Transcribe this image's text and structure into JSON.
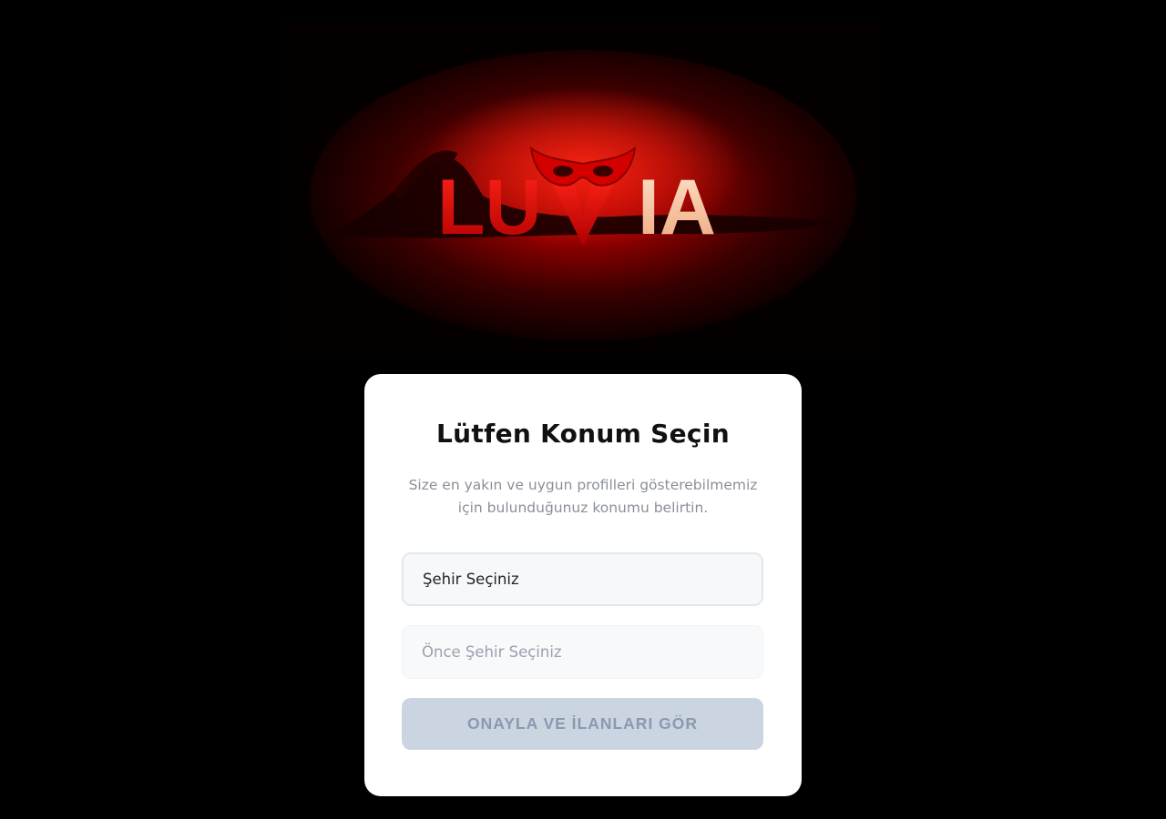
{
  "banner": {
    "logo_text_part1": "LU",
    "logo_text_part2": "IA",
    "logo_icon": "mask-icon"
  },
  "card": {
    "title": "Lütfen Konum Seçin",
    "subtitle": "Size en yakın ve uygun profilleri gösterebilmemiz için bulunduğunuz konumu belirtin.",
    "city_select_value": "Şehir Seçiniz",
    "district_select_value": "Önce Şehir Seçiniz",
    "confirm_button_label": "ONAYLA VE İLANLARI GÖR"
  },
  "colors": {
    "page_background": "#000000",
    "card_background": "#ffffff",
    "button_disabled_background": "#cbd5e1",
    "logo_red": "#e01010",
    "logo_peach": "#f5c4a0"
  }
}
